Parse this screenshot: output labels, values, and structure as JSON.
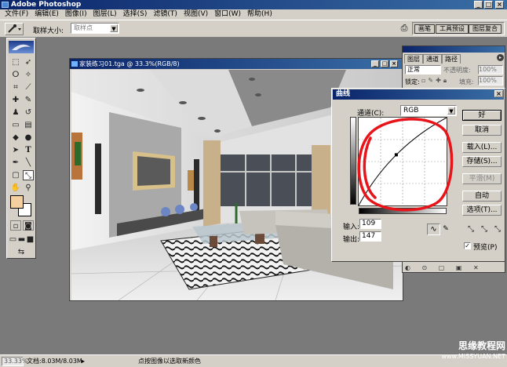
{
  "window": {
    "title": "Adobe Photoshop"
  },
  "menu": [
    "文件(F)",
    "编辑(E)",
    "图像(I)",
    "图层(L)",
    "选择(S)",
    "滤镜(T)",
    "视图(V)",
    "窗口(W)",
    "帮助(H)"
  ],
  "options_bar": {
    "sample_label": "取样大小:",
    "sample_value": "取样点",
    "well_tabs": [
      "画笔",
      "工具预设",
      "图层复合"
    ]
  },
  "document": {
    "title": "家装练习01.tga @ 33.3%(RGB/8)"
  },
  "layers_palette": {
    "tabs": [
      "图层",
      "通道",
      "路径"
    ],
    "blend_mode": "正常",
    "opacity_label": "不透明度:",
    "opacity_value": "100%",
    "lock_label": "锁定:",
    "fill_label": "填充:",
    "fill_value": "100%"
  },
  "curves": {
    "title": "曲线",
    "channel_label": "通道(C):",
    "channel_value": "RGB",
    "input_label": "输入:",
    "input_value": "109",
    "output_label": "输出:",
    "output_value": "147",
    "buttons": {
      "ok": "好",
      "cancel": "取消",
      "load": "载入(L)...",
      "save": "存储(S)...",
      "smooth": "平滑(M)",
      "auto": "自动",
      "options": "选项(T)..."
    },
    "preview_label": "预览(P)",
    "preview_checked": "✓",
    "point": {
      "input": 109,
      "output": 147
    }
  },
  "status": {
    "zoom": "33.33%",
    "doc_size": "文档:8.03M/8.03M",
    "hint": "点按图像以选取新颜色"
  },
  "watermark": {
    "cn": "思缘教程网",
    "url": "www.MISSYUAN.NET"
  },
  "colors": {
    "foreground": "#f4cfa0",
    "background": "#ffffff",
    "annotation": "#e8141a",
    "title_bar": "#0a246a"
  }
}
